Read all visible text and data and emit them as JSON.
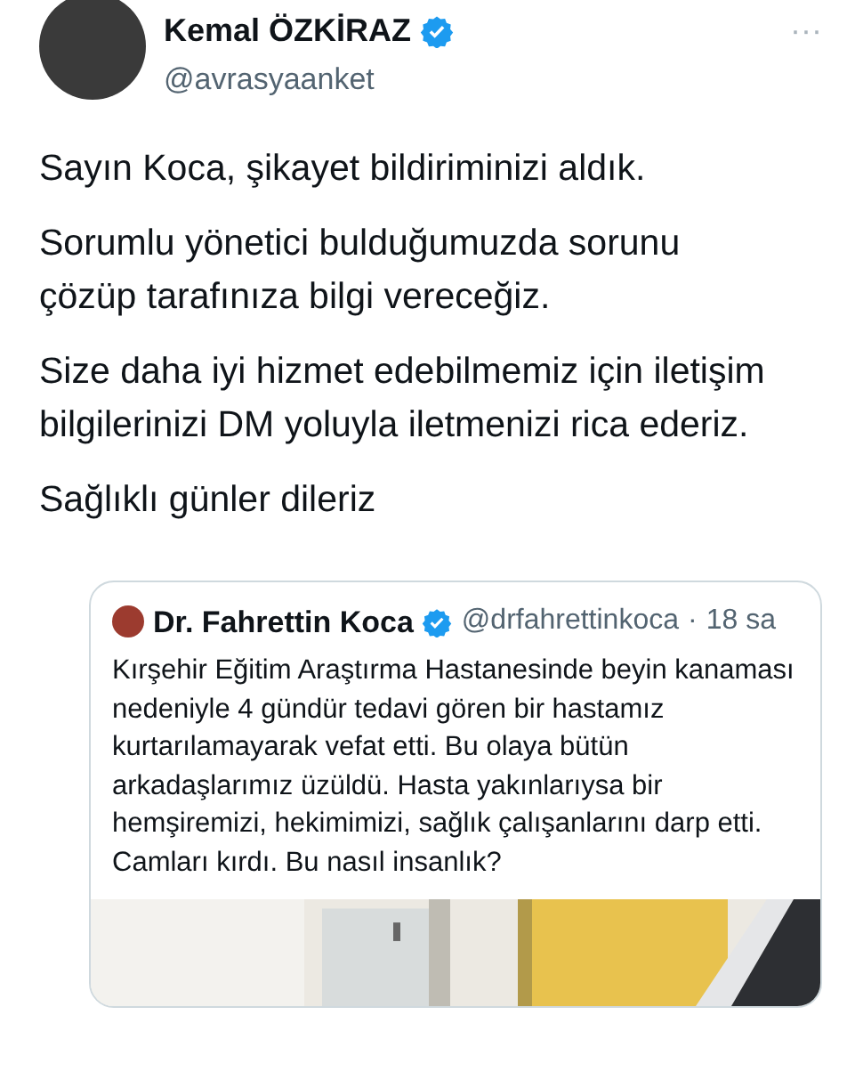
{
  "author": {
    "name": "Kemal ÖZKİRAZ",
    "verified": true,
    "handle": "@avrasyaanket"
  },
  "more": "···",
  "paragraphs": [
    "Sayın Koca, şikayet bildiriminizi aldık.",
    "Sorumlu yönetici bulduğumuzda sorunu çözüp tarafınıza bilgi vereceğiz.",
    "Size daha iyi hizmet edebilmemiz için iletişim bilgilerinizi DM yoluyla iletmenizi rica ederiz.",
    "Sağlıklı günler dileriz"
  ],
  "quoted": {
    "name": "Dr. Fahrettin Koca",
    "verified": true,
    "handle": "@drfahrettinkoca",
    "separator": "·",
    "time": "18 sa",
    "text": "Kırşehir Eğitim Araştırma Hastanesinde beyin kanaması nedeniyle 4 gündür tedavi gören bir hastamız kurtarılamayarak vefat etti. Bu olaya bütün arkadaşlarımız üzüldü. Hasta yakınlarıysa bir hemşiremizi, hekimimizi, sağlık çalışanlarını darp etti. Camları kırdı. Bu nasıl insanlık?"
  }
}
